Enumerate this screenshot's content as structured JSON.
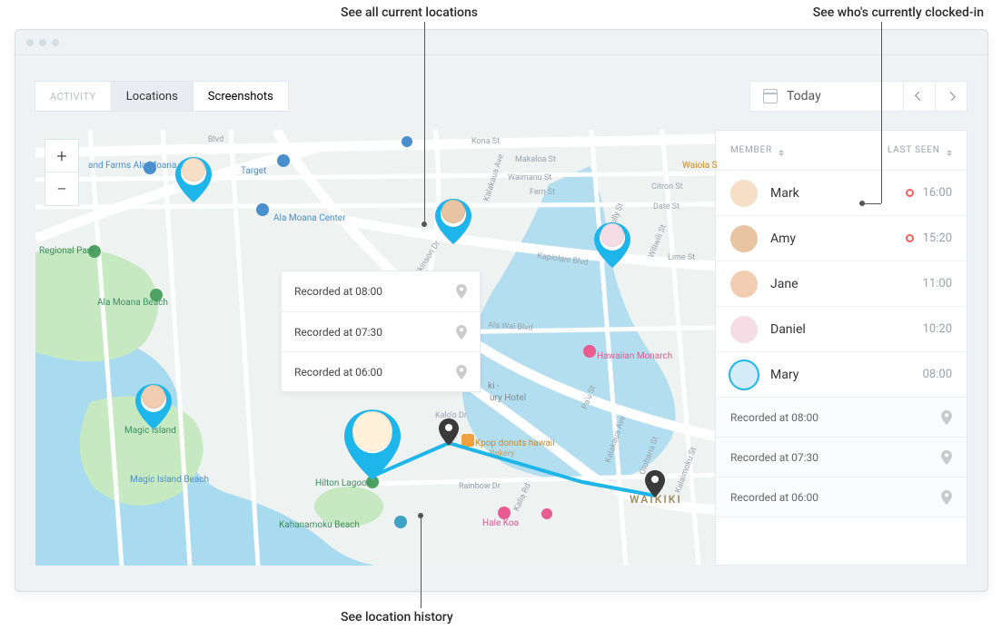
{
  "annotations": {
    "top_center": "See all current locations",
    "top_right": "See who's currently clocked-in",
    "bottom": "See location history"
  },
  "tabs": {
    "activity": "ACTIVITY",
    "locations": "Locations",
    "screenshots": "Screenshots"
  },
  "date": {
    "label": "Today"
  },
  "zoom": {
    "in": "+",
    "out": "−"
  },
  "map_history": [
    {
      "label": "Recorded at 08:00"
    },
    {
      "label": "Recorded at 07:30"
    },
    {
      "label": "Recorded at 06:00"
    }
  ],
  "sidebar": {
    "col_member": "MEMBER",
    "col_lastseen": "LAST SEEN",
    "members": [
      {
        "name": "Mark",
        "time": "16:00",
        "clocked": true,
        "tint": "#f7dec6"
      },
      {
        "name": "Amy",
        "time": "15:20",
        "clocked": true,
        "tint": "#e8c4a3"
      },
      {
        "name": "Jane",
        "time": "11:00",
        "clocked": false,
        "tint": "#f2cdb1"
      },
      {
        "name": "Daniel",
        "time": "10:20",
        "clocked": false,
        "tint": "#f6dce5"
      },
      {
        "name": "Mary",
        "time": "08:00",
        "clocked": false,
        "tint": "#d4ecf7",
        "active": true
      }
    ],
    "history": [
      {
        "label": "Recorded at 08:00"
      },
      {
        "label": "Recorded at 07:30"
      },
      {
        "label": "Recorded at 06:00"
      }
    ]
  },
  "map_labels": {
    "waiola": "Waiola Shave Ice",
    "ala_moana": "Ala Moana Center",
    "target": "Target",
    "farms": "and Farms Ala Moana",
    "regional": "Regional Park",
    "beach": "Ala Moana Beach",
    "magic": "Magic Island",
    "magicbeach": "Magic Island Beach",
    "hilton": "Hilton Lagoon",
    "kahanamoku": "Kahanamoku Beach",
    "hale": "Hale Koa",
    "monarch": "Hawaiian Monarch",
    "kpop": "Kpop donuts hawaii",
    "bakery": "Bakery",
    "hotel": "ury Hotel",
    "waikiki": "WAIKIKI",
    "kapiolani": "Kapiolani Blvd",
    "alawai": "Ala Wai Blvd",
    "rainbow": "Rainbow Dr",
    "kona": "Kona St",
    "makaloa": "Makaloa St",
    "waimanu": "Waimanu St",
    "fern": "Fern St",
    "citron": "Citron St",
    "date": "Date St",
    "lime": "Lime St",
    "atkinson": "Atkinson Dr",
    "kalo": "Kalo'o Dr",
    "kalakaua": "Kalakaua Ave",
    "kalakaua2": "Kalakaua Ave",
    "kalia": "Kalia Rd",
    "pau": "Pa'u St",
    "olohana": "Olohana St",
    "kalaimoku": "Kalaimoku St",
    "wilwili": "Wiliwili St",
    "mccully": "McCully St",
    "blvd": "Blvd",
    "ki": "ki -"
  }
}
